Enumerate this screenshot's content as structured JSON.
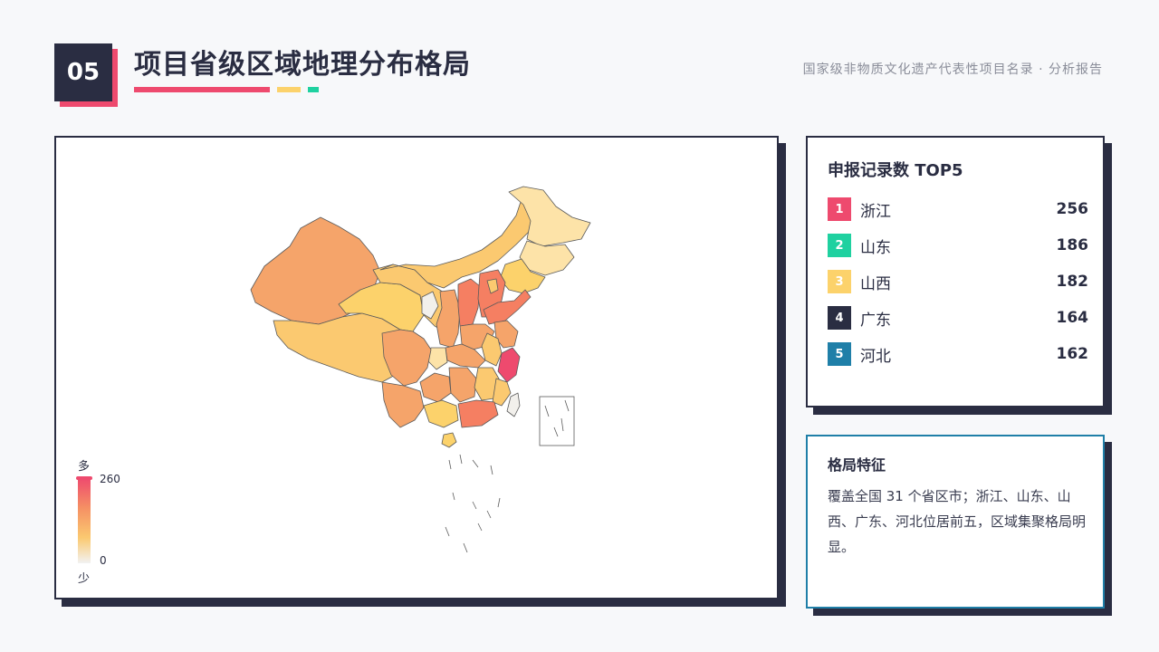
{
  "header": {
    "number": "05",
    "title": "项目省级区域地理分布格局",
    "report": "国家级非物质文化遗产代表性项目名录 · 分析报告"
  },
  "legend": {
    "top_label": "多",
    "bottom_label": "少",
    "max": "260",
    "min": "0"
  },
  "top5": {
    "title": "申报记录数 TOP5",
    "items": [
      {
        "rank": "1",
        "name": "浙江",
        "value": "256",
        "color": "#ee4a6e"
      },
      {
        "rank": "2",
        "name": "山东",
        "value": "186",
        "color": "#1fd1a0"
      },
      {
        "rank": "3",
        "name": "山西",
        "value": "182",
        "color": "#fcd26b"
      },
      {
        "rank": "4",
        "name": "广东",
        "value": "164",
        "color": "#2a2d42"
      },
      {
        "rank": "5",
        "name": "河北",
        "value": "162",
        "color": "#1f7fa8"
      }
    ]
  },
  "feature": {
    "title": "格局特征",
    "text": "覆盖全国 31 个省区市；浙江、山东、山西、广东、河北位居前五，区域集聚格局明显。"
  },
  "map_colors": {
    "high": "#ee4a6e",
    "mid_high": "#f57f62",
    "mid": "#f5a46a",
    "mid_low": "#fbc970",
    "low": "#fde3a8",
    "lowest": "#f2f0ec"
  }
}
